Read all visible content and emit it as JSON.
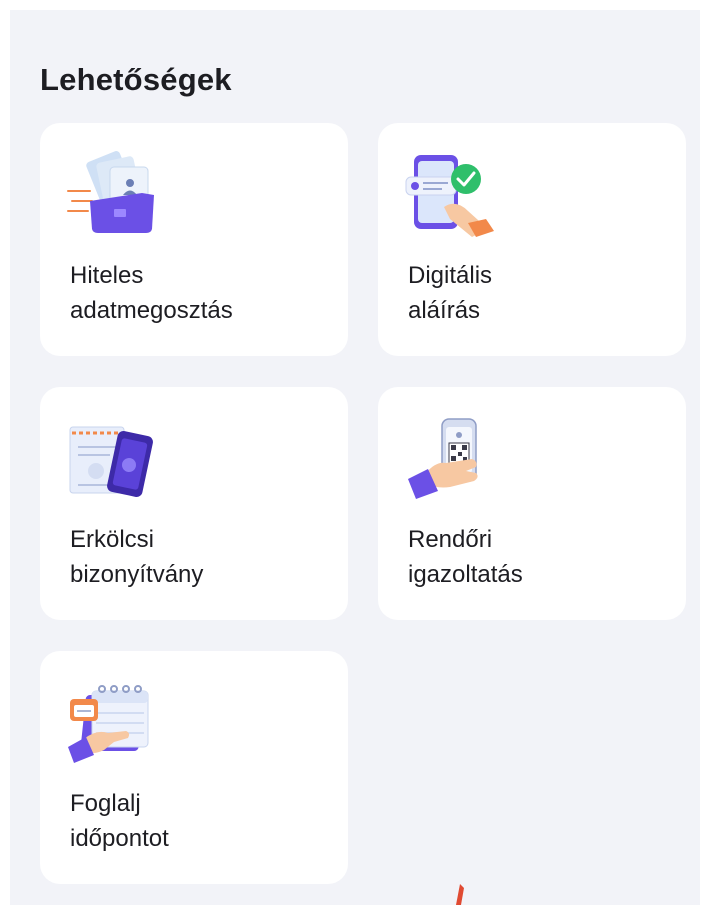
{
  "section": {
    "title": "Lehetőségek"
  },
  "options": [
    {
      "line1": "Hiteles",
      "line2": "adatmegosztás",
      "icon": "folder-documents-icon"
    },
    {
      "line1": "Digitális",
      "line2": "aláírás",
      "icon": "phone-signature-check-icon"
    },
    {
      "line1": "Erkölcsi",
      "line2": "bizonyítvány",
      "icon": "certificate-phone-icon"
    },
    {
      "line1": "Rendőri",
      "line2": "igazoltatás",
      "icon": "hand-phone-qr-icon"
    },
    {
      "line1": "Foglalj",
      "line2": "időpontot",
      "icon": "calendar-booking-icon"
    }
  ],
  "colors": {
    "background": "#f2f3f8",
    "card": "#ffffff",
    "accent_purple": "#6b50e6",
    "accent_green": "#2fbf6b",
    "accent_orange": "#f2894a"
  }
}
